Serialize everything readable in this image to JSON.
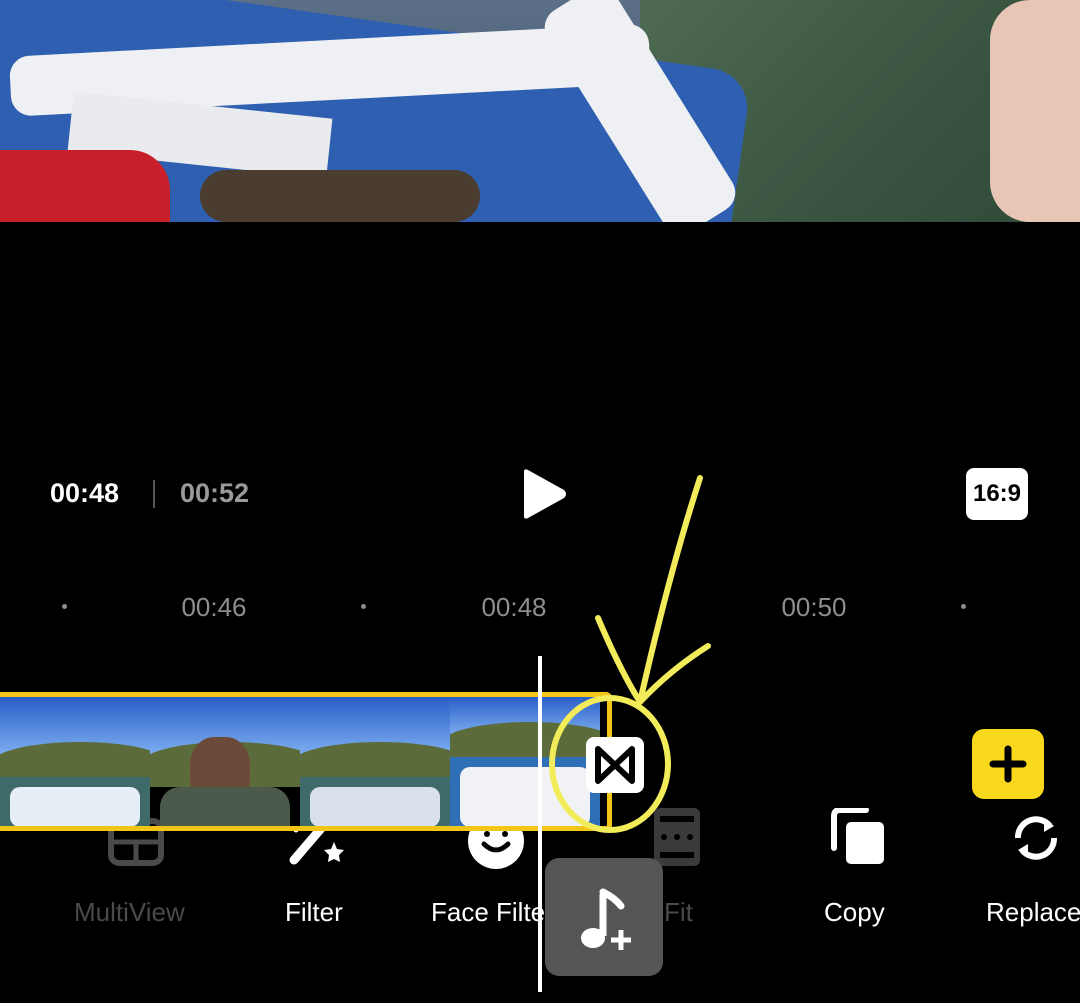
{
  "player": {
    "current_time": "00:48",
    "total_time": "00:52",
    "aspect_ratio": "16:9"
  },
  "ruler": {
    "ticks": [
      "00:46",
      "00:48",
      "00:50"
    ]
  },
  "toolbar": {
    "items": [
      {
        "label": "MultiView",
        "icon": "multiview-icon",
        "enabled": false
      },
      {
        "label": "Filter",
        "icon": "magic-wand-icon",
        "enabled": true
      },
      {
        "label": "Face Filter",
        "icon": "face-filter-icon",
        "enabled": true
      },
      {
        "label": "Fit",
        "icon": "fit-icon",
        "enabled": false
      },
      {
        "label": "Copy",
        "icon": "copy-icon",
        "enabled": true
      },
      {
        "label": "Replace",
        "icon": "replace-icon",
        "enabled": true
      }
    ]
  },
  "colors": {
    "accent": "#f5c518",
    "annotation": "#f2ec5a",
    "background": "#000000"
  }
}
